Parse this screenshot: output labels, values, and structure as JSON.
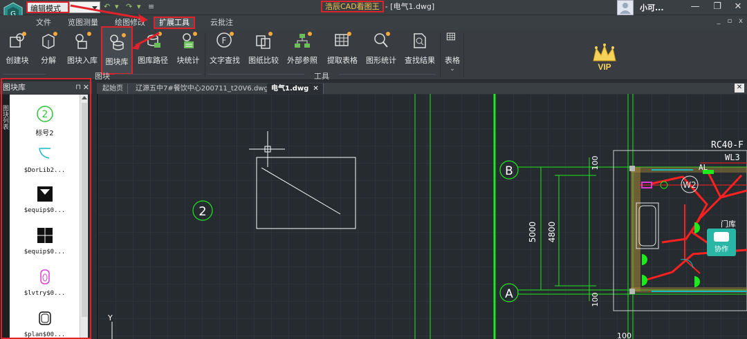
{
  "titlebar": {
    "mode_label": "编辑模式",
    "app_name": "浩辰CAD看图王",
    "file_title": "- [电气1.dwg]",
    "user_name": "小可...",
    "minimize": "—",
    "restore": "❐",
    "close": "✕"
  },
  "tabs": [
    "文件",
    "览图测量",
    "绘图修改",
    "扩展工具",
    "云批注"
  ],
  "mdi": {
    "min": "_",
    "restore": "▫",
    "close": "x"
  },
  "ribbon": {
    "buttons": [
      "创建块",
      "分解",
      "图块入库",
      "图块库",
      "图库路径",
      "块统计",
      "文字查找",
      "图纸比较",
      "外部参照",
      "提取表格",
      "图形统计",
      "查找结果",
      "表格"
    ],
    "groups": [
      "图块",
      "工具"
    ]
  },
  "vip_label": "VIP",
  "panel": {
    "title": "图块库",
    "pin": "⊓",
    "close": "✕",
    "vertical_tab": "图块列表",
    "items": [
      {
        "caption": "标号2",
        "symbol": "2"
      },
      {
        "caption": "$DorLib2..."
      },
      {
        "caption": "$equip$0..."
      },
      {
        "caption": "$equip$0..."
      },
      {
        "caption": "$lvtry$0..."
      },
      {
        "caption": "$plan$00..."
      }
    ]
  },
  "doc_tabs": [
    {
      "label": "起始页",
      "active": false
    },
    {
      "label": "辽源五中7#餐饮中心200711_t20V6.dwg",
      "active": false
    },
    {
      "label": "电气1.dwg",
      "active": true,
      "close": "✕"
    }
  ],
  "doc_close": "✕",
  "drawing": {
    "circle_label": "2",
    "axis_B": "B",
    "axis_A": "A",
    "dim_5000": "5000",
    "dim_4800": "4800",
    "dim_100_top": "100",
    "dim_100_bottom": "100",
    "dim_100_low": "100",
    "rc_label": "RC40-F",
    "wl_label": "WL3",
    "al_label": "AL",
    "w2_label": "W2",
    "door_label": "门库",
    "y_label": "Y"
  },
  "collab_label": "协作",
  "colors": {
    "highlight_red": "#e0232b",
    "cad_green": "#1ee81e",
    "cad_red": "#ff2020",
    "collab_teal": "#29b6a7"
  }
}
